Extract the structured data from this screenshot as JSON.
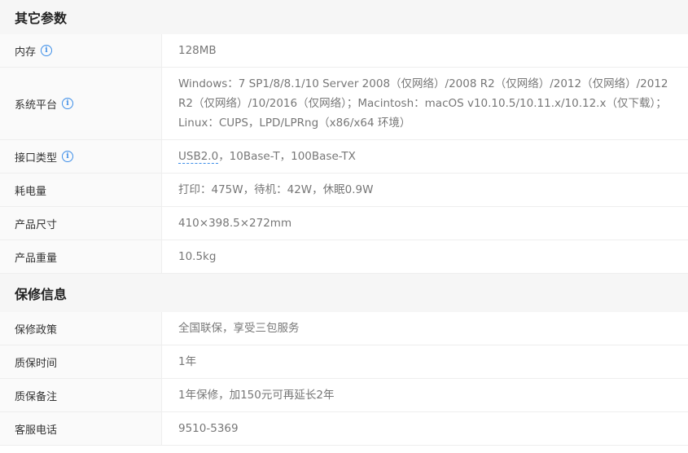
{
  "sections": {
    "other_params": {
      "title": "其它参数",
      "rows": {
        "memory": {
          "label": "内存",
          "value": "128MB"
        },
        "platform": {
          "label": "系统平台",
          "value": "Windows：7 SP1/8/8.1/10 Server 2008（仅网络）/2008 R2（仅网络）/2012（仅网络）/2012 R2（仅网络）/10/2016（仅网络）；Macintosh：macOS v10.10.5/10.11.x/10.12.x（仅下载）；Linux：CUPS，LPD/LPRng（x86/x64 环境）"
        },
        "interface": {
          "label": "接口类型",
          "link": "USB2.0",
          "rest": "，10Base-T，100Base-TX"
        },
        "power": {
          "label": "耗电量",
          "value": "打印：475W，待机：42W，休眠0.9W"
        },
        "size": {
          "label": "产品尺寸",
          "value": "410×398.5×272mm"
        },
        "weight": {
          "label": "产品重量",
          "value": "10.5kg"
        }
      }
    },
    "warranty": {
      "title": "保修信息",
      "rows": {
        "policy": {
          "label": "保修政策",
          "value": "全国联保，享受三包服务"
        },
        "period": {
          "label": "质保时间",
          "value": "1年"
        },
        "note": {
          "label": "质保备注",
          "value": "1年保修，加150元可再延长2年"
        },
        "hotline": {
          "label": "客服电话",
          "value": "9510-5369"
        }
      }
    }
  },
  "icons": {
    "info": "info-circle-icon",
    "accent_color": "#3d8ee8"
  }
}
